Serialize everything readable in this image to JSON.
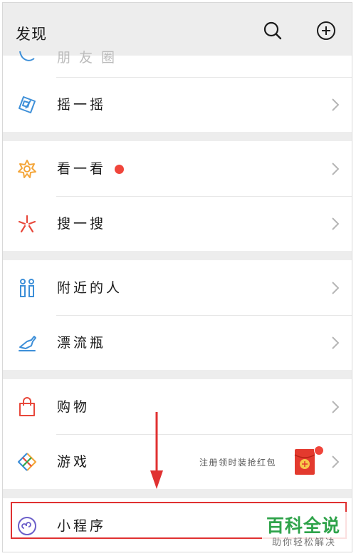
{
  "header": {
    "title": "发现",
    "search_icon": "search-icon",
    "add_icon": "plus-circle-icon"
  },
  "groups": [
    {
      "items": [
        {
          "label": "朋友圈",
          "icon": "moments-icon",
          "partial": true
        },
        {
          "label": "摇一摇",
          "icon": "shake-icon"
        }
      ]
    },
    {
      "items": [
        {
          "label": "看一看",
          "icon": "top-stories-icon",
          "badge": "dot"
        },
        {
          "label": "搜一搜",
          "icon": "search-sparkle-icon"
        }
      ]
    },
    {
      "items": [
        {
          "label": "附近的人",
          "icon": "people-nearby-icon"
        },
        {
          "label": "漂流瓶",
          "icon": "drift-bottle-icon"
        }
      ]
    },
    {
      "items": [
        {
          "label": "购物",
          "icon": "shopping-bag-icon"
        },
        {
          "label": "游戏",
          "icon": "games-icon",
          "note": "注册领时装抢红包",
          "thumb": "red-packet-icon"
        }
      ]
    },
    {
      "items": [
        {
          "label": "小程序",
          "icon": "mini-programs-icon"
        }
      ]
    }
  ],
  "colors": {
    "background": "#ededed",
    "badge": "#f0453b",
    "highlight": "#e03131",
    "watermark": "#2fa34a"
  },
  "watermark": {
    "main": "百科全说",
    "sub": "助你轻松解决"
  }
}
